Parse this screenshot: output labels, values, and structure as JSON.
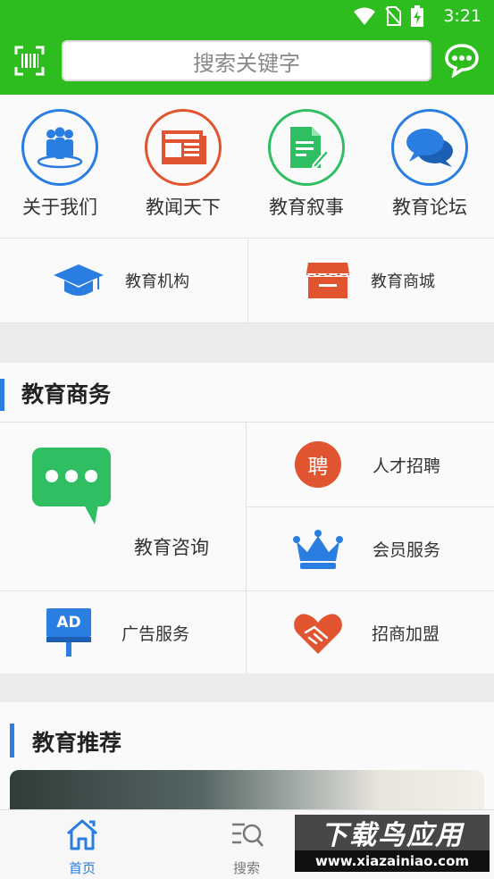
{
  "status": {
    "time": "3:21"
  },
  "header": {
    "search_placeholder": "搜索关键字",
    "brand_color": "#2ebd1e"
  },
  "quick_links": [
    {
      "label": "关于我们",
      "icon": "people-group-icon",
      "color": "#2a7de1"
    },
    {
      "label": "教闻天下",
      "icon": "newspaper-icon",
      "color": "#e0552f"
    },
    {
      "label": "教育叙事",
      "icon": "document-edit-icon",
      "color": "#2fbe62"
    },
    {
      "label": "教育论坛",
      "icon": "chat-bubbles-icon",
      "color": "#2a7de1"
    }
  ],
  "secondary": [
    {
      "label": "教育机构",
      "icon": "graduation-cap-icon"
    },
    {
      "label": "教育商城",
      "icon": "storefront-icon"
    }
  ],
  "business": {
    "title": "教育商务",
    "consult": {
      "label": "教育咨询",
      "icon": "chat-message-icon"
    },
    "recruit": {
      "label": "人才招聘",
      "icon_text": "聘"
    },
    "member": {
      "label": "会员服务",
      "icon": "crown-icon"
    },
    "ads": {
      "label": "广告服务",
      "icon_text": "AD"
    },
    "franchise": {
      "label": "招商加盟",
      "icon": "handshake-heart-icon"
    }
  },
  "recommend": {
    "title": "教育推荐"
  },
  "bottom_nav": [
    {
      "label": "首页",
      "icon": "home-icon",
      "active": true
    },
    {
      "label": "搜索",
      "icon": "search-list-icon",
      "active": false
    }
  ],
  "watermark": {
    "title": "下载鸟应用",
    "url": "www.xiazainiao.com"
  }
}
